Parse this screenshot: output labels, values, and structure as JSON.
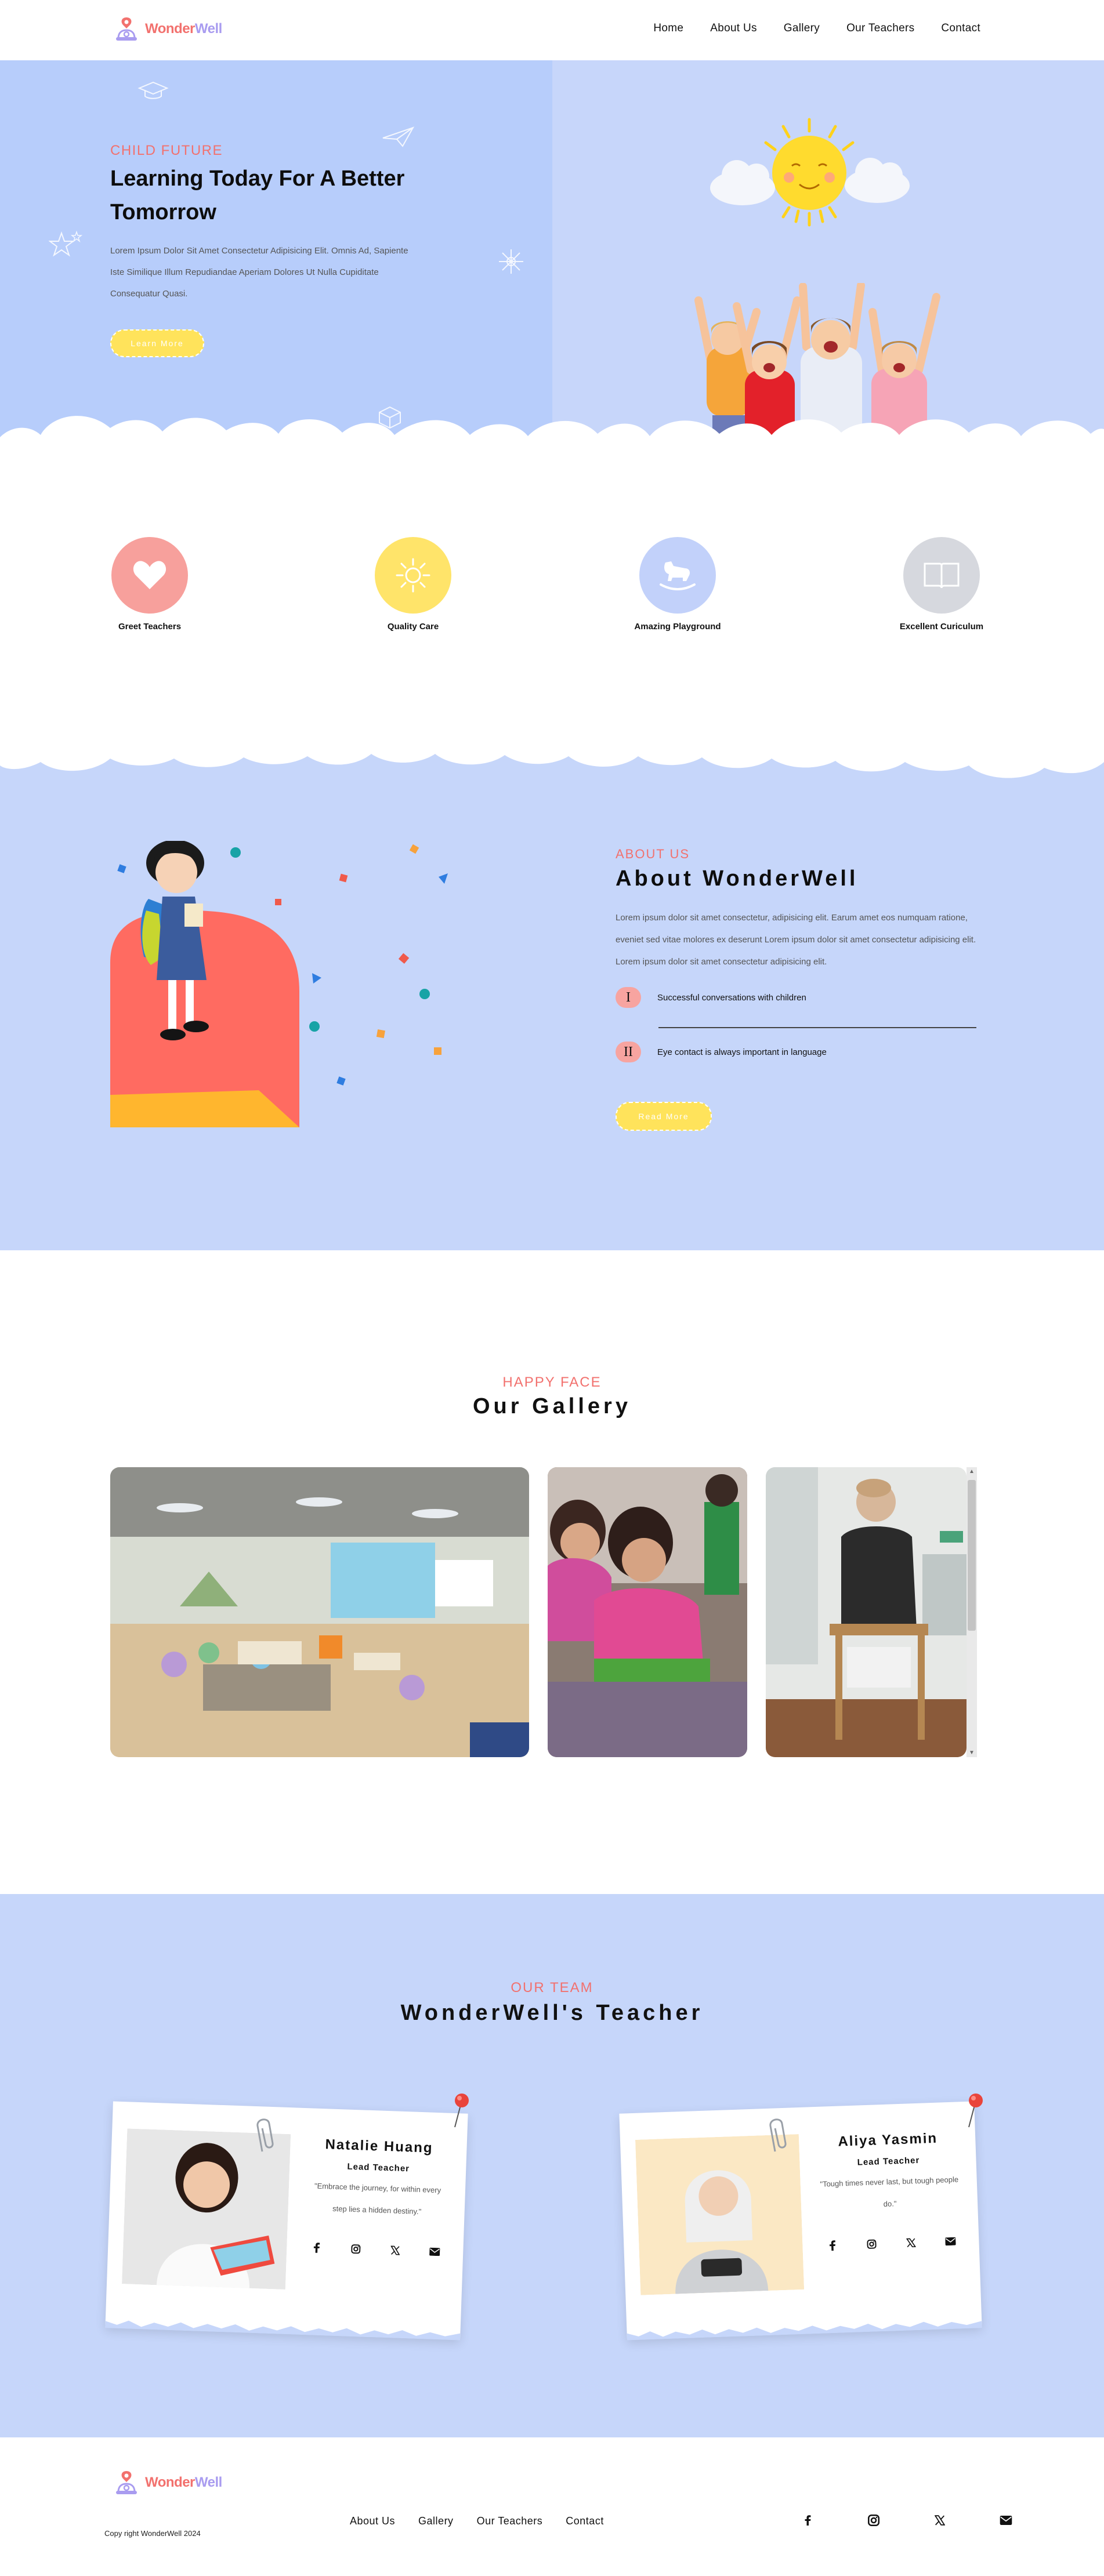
{
  "brand": {
    "logo_part1": "Wonder",
    "logo_part2": "Well"
  },
  "nav": {
    "items": [
      {
        "label": "Home"
      },
      {
        "label": "About Us"
      },
      {
        "label": "Gallery"
      },
      {
        "label": "Our Teachers"
      },
      {
        "label": "Contact"
      }
    ]
  },
  "hero": {
    "eyebrow": "CHILD FUTURE",
    "title": "Learning Today For A Better Tomorrow",
    "text": "Lorem Ipsum Dolor Sit Amet Consectetur Adipisicing Elit. Omnis Ad, Sapiente Iste Similique Illum Repudiandae Aperiam Dolores Ut Nulla Cupiditate Consequatur Quasi.",
    "button": "Learn More"
  },
  "features": [
    {
      "label": "Greet Teachers",
      "icon": "heart-icon",
      "color": "#f7a09c"
    },
    {
      "label": "Quality Care",
      "icon": "sun-icon",
      "color": "#ffe46a"
    },
    {
      "label": "Amazing Playground",
      "icon": "rocking-horse-icon",
      "color": "#c2d1fa"
    },
    {
      "label": "Excellent Curiculum",
      "icon": "book-icon",
      "color": "#d6d8de"
    }
  ],
  "about": {
    "eyebrow": "ABOUT US",
    "title": "About WonderWell",
    "text": "Lorem ipsum dolor sit amet consectetur, adipisicing elit. Earum amet eos numquam ratione, eveniet sed vitae molores ex deserunt Lorem ipsum dolor sit amet consectetur adipisicing elit. Lorem ipsum dolor sit amet consectetur adipisicing elit.",
    "items": [
      {
        "numeral": "I",
        "text": "Successful conversations with children"
      },
      {
        "numeral": "II",
        "text": "Eye contact is always important in language"
      }
    ],
    "button": "Read More"
  },
  "gallery": {
    "eyebrow": "HAPPY FACE",
    "title": "Our Gallery"
  },
  "team": {
    "eyebrow": "OUR TEAM",
    "title": "WonderWell's Teacher",
    "members": [
      {
        "name": "Natalie Huang",
        "role": "Lead Teacher",
        "quote": "\"Embrace the journey, for within every step lies a hidden destiny.\""
      },
      {
        "name": "Aliya Yasmin",
        "role": "Lead Teacher",
        "quote": "\"Tough times never last, but tough people do.\""
      }
    ]
  },
  "footer": {
    "copyright": "Copy right WonderWell 2024",
    "links": [
      {
        "label": "About Us"
      },
      {
        "label": "Gallery"
      },
      {
        "label": "Our Teachers"
      },
      {
        "label": "Contact"
      }
    ],
    "socials": [
      "facebook-icon",
      "instagram-icon",
      "x-icon",
      "mail-icon"
    ]
  },
  "colors": {
    "accent": "#f2716e",
    "brand_purple": "#a99cf0",
    "button_yellow": "#ffe35b",
    "hero_blue": "#b7cdfb",
    "section_blue": "#c6d6fa"
  }
}
